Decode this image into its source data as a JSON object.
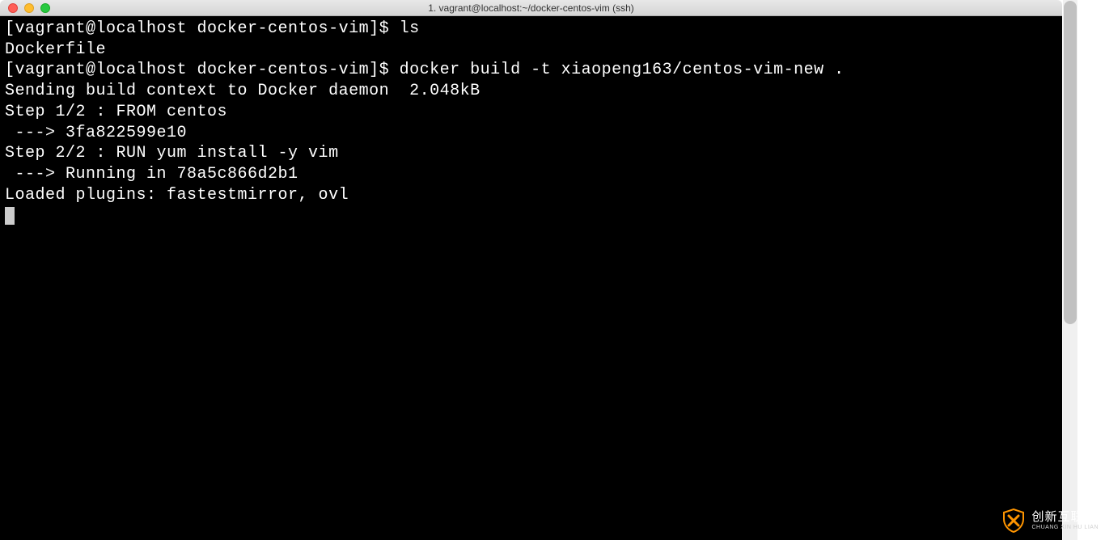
{
  "window": {
    "title": "1. vagrant@localhost:~/docker-centos-vim (ssh)"
  },
  "terminal": {
    "lines": [
      {
        "type": "prompt",
        "prompt": "[vagrant@localhost docker-centos-vim]$ ",
        "cmd": "ls"
      },
      {
        "type": "output",
        "text": "Dockerfile"
      },
      {
        "type": "prompt",
        "prompt": "[vagrant@localhost docker-centos-vim]$ ",
        "cmd": "docker build -t xiaopeng163/centos-vim-new ."
      },
      {
        "type": "output",
        "text": "Sending build context to Docker daemon  2.048kB"
      },
      {
        "type": "output",
        "text": "Step 1/2 : FROM centos"
      },
      {
        "type": "output",
        "text": " ---> 3fa822599e10"
      },
      {
        "type": "output",
        "text": "Step 2/2 : RUN yum install -y vim"
      },
      {
        "type": "output",
        "text": " ---> Running in 78a5c866d2b1"
      },
      {
        "type": "output",
        "text": "Loaded plugins: fastestmirror, ovl"
      }
    ]
  },
  "watermark": {
    "cn": "创新互联",
    "en": "CHUANG XIN HU LIAN"
  }
}
